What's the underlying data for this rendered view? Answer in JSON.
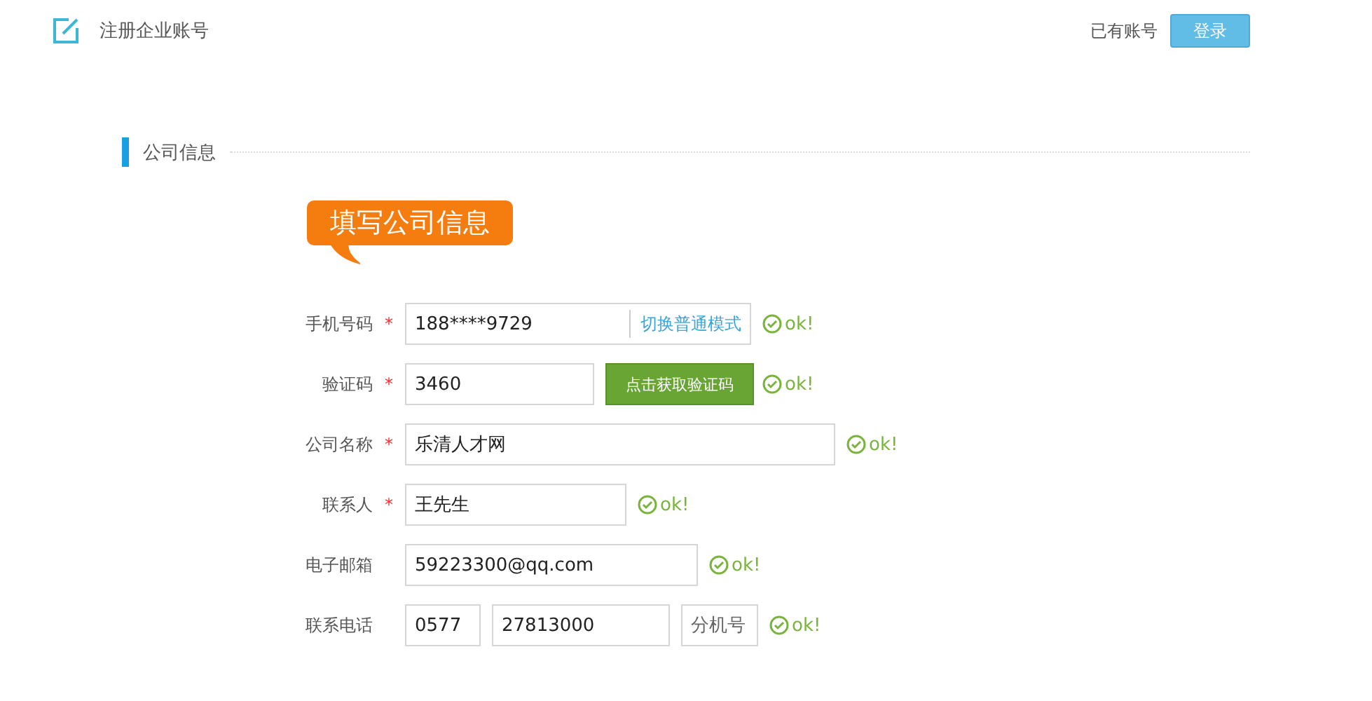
{
  "header": {
    "title": "注册企业账号",
    "account_prompt": "已有账号",
    "login_button": "登录"
  },
  "section": {
    "title": "公司信息"
  },
  "callout": "填写公司信息",
  "required_mark": "*",
  "fields": [
    {
      "kind": "phone",
      "label": "手机号码",
      "required": true,
      "value": "188****9729",
      "link": "切换普通模式",
      "status": "ok!",
      "valid": true
    },
    {
      "kind": "code",
      "label": "验证码",
      "required": true,
      "value": "3460",
      "button": "点击获取验证码",
      "status": "ok!",
      "valid": true
    },
    {
      "kind": "text",
      "label": "公司名称",
      "required": true,
      "value": "乐清人才网",
      "status": "ok!",
      "valid": true
    },
    {
      "kind": "text",
      "label": "联系人",
      "required": true,
      "value": "王先生",
      "status": "ok!",
      "valid": true
    },
    {
      "kind": "text",
      "label": "电子邮箱",
      "required": false,
      "value": "59223300@qq.com",
      "status": "ok!",
      "valid": true
    },
    {
      "kind": "tel",
      "label": "联系电话",
      "required": false,
      "area": "0577",
      "value": "27813000",
      "placeholder": "分机号",
      "status": "ok!",
      "valid": true
    }
  ]
}
